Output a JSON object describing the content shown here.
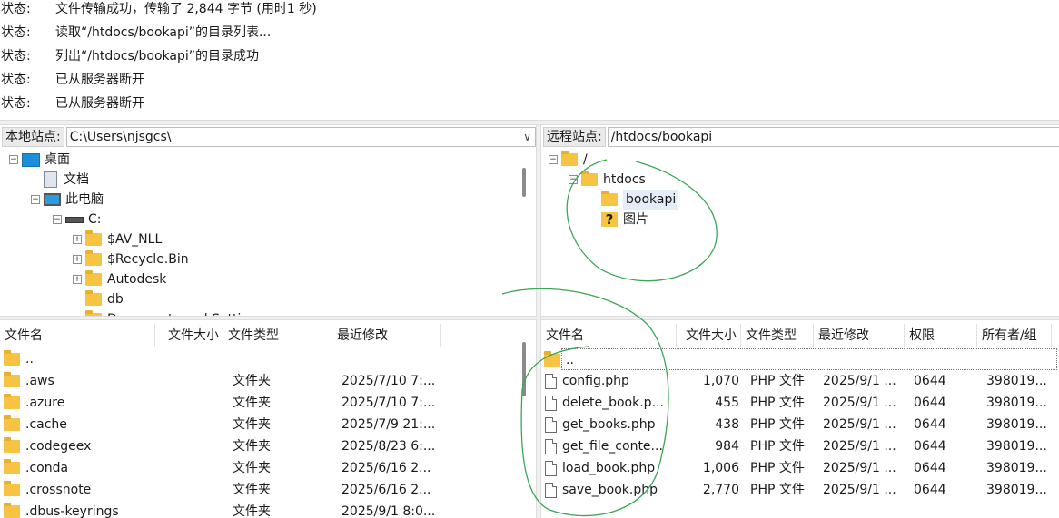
{
  "log": [
    {
      "label": "状态:",
      "message": "文件传输成功，传输了 2,844 字节 (用时1 秒)"
    },
    {
      "label": "状态:",
      "message": "读取“/htdocs/bookapi”的目录列表..."
    },
    {
      "label": "状态:",
      "message": "列出“/htdocs/bookapi”的目录成功"
    },
    {
      "label": "状态:",
      "message": "已从服务器断开"
    },
    {
      "label": "状态:",
      "message": "已从服务器断开"
    }
  ],
  "local": {
    "site_label": "本地站点:",
    "site_path": "C:\\Users\\njsgcs\\",
    "tree": [
      {
        "label": "桌面",
        "icon": "desktop-icon",
        "expander": "−"
      },
      {
        "label": "文档",
        "icon": "document-icon",
        "expander": ""
      },
      {
        "label": "此电脑",
        "icon": "computer-icon",
        "expander": "−"
      },
      {
        "label": "C:",
        "icon": "drive-icon",
        "expander": "−"
      },
      {
        "label": "$AV_NLL",
        "icon": "folder-icon",
        "expander": "+"
      },
      {
        "label": "$Recycle.Bin",
        "icon": "folder-icon",
        "expander": "+"
      },
      {
        "label": "Autodesk",
        "icon": "folder-icon",
        "expander": "+"
      },
      {
        "label": "db",
        "icon": "folder-icon",
        "expander": ""
      },
      {
        "label": "Documents and Settings",
        "icon": "folder-icon",
        "expander": ""
      }
    ],
    "columns": [
      "文件名",
      "文件大小",
      "文件类型",
      "最近修改"
    ],
    "files": [
      {
        "name": "..",
        "size": "",
        "type": "",
        "modified": ""
      },
      {
        "name": ".aws",
        "size": "",
        "type": "文件夹",
        "modified": "2025/7/10 7:..."
      },
      {
        "name": ".azure",
        "size": "",
        "type": "文件夹",
        "modified": "2025/7/10 7:..."
      },
      {
        "name": ".cache",
        "size": "",
        "type": "文件夹",
        "modified": "2025/7/9 21:..."
      },
      {
        "name": ".codegeex",
        "size": "",
        "type": "文件夹",
        "modified": "2025/8/23 6:..."
      },
      {
        "name": ".conda",
        "size": "",
        "type": "文件夹",
        "modified": "2025/6/16 2..."
      },
      {
        "name": ".crossnote",
        "size": "",
        "type": "文件夹",
        "modified": "2025/6/16 2..."
      },
      {
        "name": ".dbus-keyrings",
        "size": "",
        "type": "文件夹",
        "modified": "2025/9/1 8:0..."
      }
    ]
  },
  "remote": {
    "site_label": "远程站点:",
    "site_path": "/htdocs/bookapi",
    "tree": [
      {
        "label": "/",
        "icon": "folder-icon",
        "expander": "−"
      },
      {
        "label": "htdocs",
        "icon": "folder-icon",
        "expander": "−"
      },
      {
        "label": "bookapi",
        "icon": "folder-icon",
        "expander": "",
        "selected": true
      },
      {
        "label": "图片",
        "icon": "unknown-folder-icon",
        "expander": ""
      }
    ],
    "columns": [
      "文件名",
      "文件大小",
      "文件类型",
      "最近修改",
      "权限",
      "所有者/组"
    ],
    "files": [
      {
        "name": "..",
        "size": "",
        "type": "",
        "modified": "",
        "perm": "",
        "owner": "",
        "icon": "folder-icon"
      },
      {
        "name": "config.php",
        "size": "1,070",
        "type": "PHP 文件",
        "modified": "2025/9/1 ...",
        "perm": "0644",
        "owner": "398019...",
        "icon": "file-icon"
      },
      {
        "name": "delete_book.p...",
        "size": "455",
        "type": "PHP 文件",
        "modified": "2025/9/1 ...",
        "perm": "0644",
        "owner": "398019...",
        "icon": "file-icon"
      },
      {
        "name": "get_books.php",
        "size": "438",
        "type": "PHP 文件",
        "modified": "2025/9/1 ...",
        "perm": "0644",
        "owner": "398019...",
        "icon": "file-icon"
      },
      {
        "name": "get_file_conte...",
        "size": "984",
        "type": "PHP 文件",
        "modified": "2025/9/1 ...",
        "perm": "0644",
        "owner": "398019...",
        "icon": "file-icon"
      },
      {
        "name": "load_book.php",
        "size": "1,006",
        "type": "PHP 文件",
        "modified": "2025/9/1 ...",
        "perm": "0644",
        "owner": "398019...",
        "icon": "file-icon"
      },
      {
        "name": "save_book.php",
        "size": "2,770",
        "type": "PHP 文件",
        "modified": "2025/9/1 ...",
        "perm": "0644",
        "owner": "398019...",
        "icon": "file-icon"
      }
    ]
  },
  "annotation_color": "#3aa655"
}
